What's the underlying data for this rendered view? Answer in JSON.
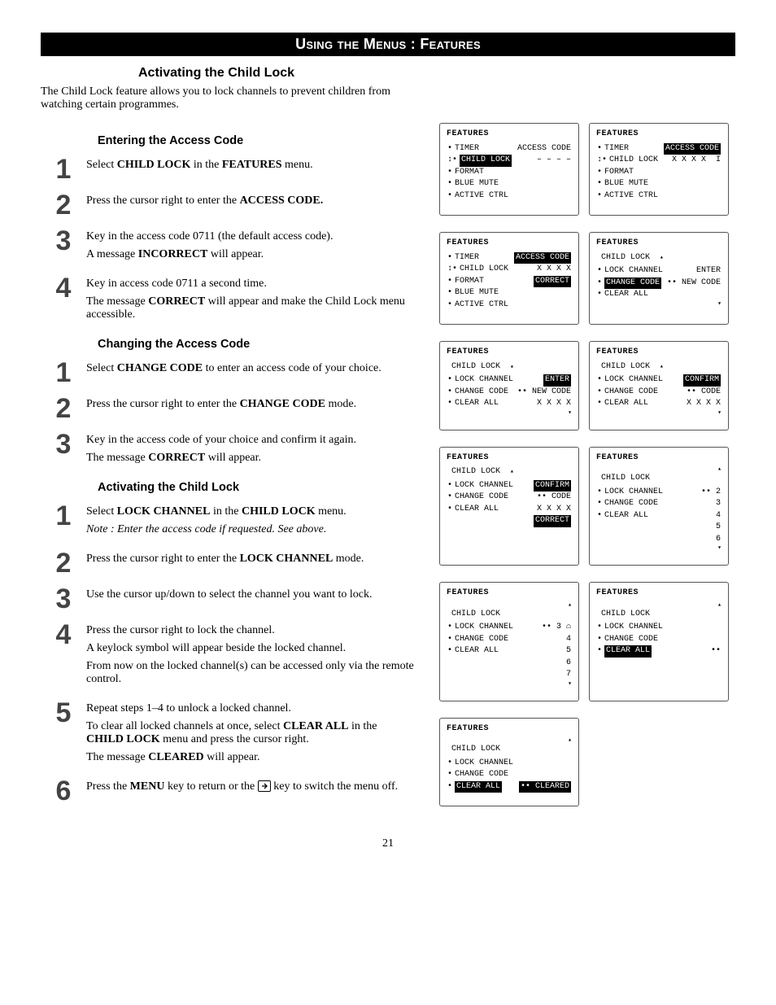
{
  "banner": "Using the Menus : Features",
  "main_heading": "Activating the Child Lock",
  "intro": "The Child Lock feature allows you to lock channels to prevent children from watching certain programmes.",
  "sections": {
    "enter": {
      "heading": "Entering the Access Code",
      "steps": [
        {
          "num": "1",
          "paras": [
            "Select <b>CHILD LOCK</b> in the <b>FEATURES</b> menu."
          ]
        },
        {
          "num": "2",
          "paras": [
            "Press the cursor right to enter the <b>ACCESS CODE.</b>"
          ]
        },
        {
          "num": "3",
          "paras": [
            "Key in the access code 0711 (the default access code).",
            "A message <b>INCORRECT</b> will appear."
          ]
        },
        {
          "num": "4",
          "paras": [
            "Key in access code 0711 a second time.",
            "The message <b>CORRECT</b> will appear and make the Child Lock menu accessible."
          ]
        }
      ]
    },
    "change": {
      "heading": "Changing the Access Code",
      "steps": [
        {
          "num": "1",
          "paras": [
            "Select <b>CHANGE CODE</b> to enter an access code of your choice."
          ]
        },
        {
          "num": "2",
          "paras": [
            "Press the cursor right to enter the <b>CHANGE CODE</b> mode."
          ]
        },
        {
          "num": "3",
          "paras": [
            "Key in the access code of your choice and confirm it again.",
            "The message <b>CORRECT</b> will appear."
          ]
        }
      ]
    },
    "activate": {
      "heading": "Activating the Child Lock",
      "steps": [
        {
          "num": "1",
          "paras": [
            "Select <b>LOCK CHANNEL</b> in the <b>CHILD LOCK</b> menu.",
            "<em class='note'>Note : Enter the access code if requested. See above.</em>"
          ]
        },
        {
          "num": "2",
          "paras": [
            "Press the cursor right to enter the <b>LOCK CHANNEL</b> mode."
          ]
        },
        {
          "num": "3",
          "paras": [
            "Use the cursor up/down to select the channel you want to lock."
          ]
        },
        {
          "num": "4",
          "paras": [
            "Press the cursor right to lock the channel.",
            "A keylock symbol will appear beside the locked channel.",
            "From now on the locked channel(s) can be accessed only via the remote control."
          ]
        },
        {
          "num": "5",
          "paras": [
            "Repeat steps 1–4 to unlock a locked channel.",
            "To clear all locked channels at once, select <b>CLEAR ALL</b> in the <b>CHILD LOCK</b> menu and press the cursor right.",
            "The message <b>CLEARED</b> will appear."
          ]
        },
        {
          "num": "6",
          "paras": [
            "Press the <b>MENU</b> key to return or the {EXIT} key to switch the menu off."
          ]
        }
      ]
    }
  },
  "panels": {
    "features_items": [
      "TIMER",
      "CHILD LOCK",
      "FORMAT",
      "BLUE MUTE",
      "ACTIVE CTRL"
    ],
    "childlock_items": [
      "LOCK CHANNEL",
      "CHANGE CODE",
      "CLEAR ALL"
    ],
    "title": "FEATURES",
    "child_title": "CHILD LOCK",
    "labels": {
      "access_code": "ACCESS CODE",
      "dashes": "– – – –",
      "xxxx": "X X X X",
      "incorrect": "I",
      "correct": "CORRECT",
      "enter": "ENTER",
      "new_code": "NEW CODE",
      "confirm": "CONFIRM",
      "code": "CODE",
      "cleared": "CLEARED"
    },
    "channels_a": [
      "3",
      "4",
      "5",
      "6",
      "7"
    ],
    "channels_b": [
      "2",
      "3",
      "4",
      "5",
      "6"
    ]
  },
  "page_number": "21"
}
